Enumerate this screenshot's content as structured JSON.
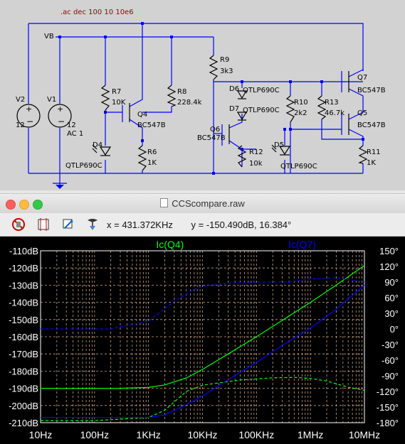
{
  "schematic": {
    "sim_command": ".ac dec 100 10 10e6",
    "net_labels": {
      "vb": "VB"
    },
    "components": {
      "v2": {
        "name": "V2",
        "value": "12"
      },
      "v1": {
        "name": "V1",
        "value1": "12",
        "value2": "AC 1"
      },
      "r7": {
        "name": "R7",
        "value": "10K"
      },
      "q4": {
        "name": "Q4",
        "value": "BC547B"
      },
      "d4": {
        "name": "D4",
        "value": "QTLP690C"
      },
      "r8": {
        "name": "R8",
        "value": "228.4k"
      },
      "r6": {
        "name": "R6",
        "value": "1K"
      },
      "r9": {
        "name": "R9",
        "value": "3k3"
      },
      "d6": {
        "name": "D6",
        "value": "QTLP690C"
      },
      "d7": {
        "name": "D7",
        "value": "QTLP690C"
      },
      "q6": {
        "name": "Q6",
        "value": "BC547B"
      },
      "r12": {
        "name": "R12",
        "value": "10k"
      },
      "d5": {
        "name": "D5",
        "value": "QTLP690C"
      },
      "r10": {
        "name": "R10",
        "value": "2k2"
      },
      "r13": {
        "name": "R13",
        "value": "46.7k"
      },
      "q7": {
        "name": "Q7",
        "value": "BC547B"
      },
      "q5": {
        "name": "Q5",
        "value": "BC547B"
      },
      "r11": {
        "name": "R11",
        "value": "1K"
      }
    }
  },
  "window": {
    "title": "CCScompare.raw"
  },
  "toolbar": {
    "x_readout": "x = 431.372KHz",
    "y_readout": "y = -150.490dB, 16.384°",
    "icons": [
      "no-cursor-icon",
      "autorange-icon",
      "zoom-icon",
      "probe-icon"
    ]
  },
  "colors": {
    "green": "#00ff00",
    "blue": "#0000ff",
    "grid": "#c8a080",
    "axis_text": "#ffffff"
  },
  "chart_data": {
    "type": "line",
    "xscale": "log",
    "xlim": [
      10,
      10000000
    ],
    "x_ticks": [
      10,
      100,
      1000,
      10000,
      100000,
      1000000,
      10000000
    ],
    "x_tick_labels": [
      "10Hz",
      "100Hz",
      "1KHz",
      "10KHz",
      "100KHz",
      "1MHz",
      "10MHz"
    ],
    "ylim_left": [
      -210,
      -110
    ],
    "y_left_ticks": [
      -110,
      -120,
      -130,
      -140,
      -150,
      -160,
      -170,
      -180,
      -190,
      -200,
      -210
    ],
    "y_left_tick_labels": [
      "-110dB",
      "-120dB",
      "-130dB",
      "-140dB",
      "-150dB",
      "-160dB",
      "-170dB",
      "-180dB",
      "-190dB",
      "-200dB",
      "-210dB"
    ],
    "ylim_right": [
      -180,
      150
    ],
    "y_right_ticks": [
      150,
      120,
      90,
      60,
      30,
      0,
      -30,
      -60,
      -90,
      -120,
      -150,
      -180
    ],
    "y_right_tick_labels": [
      "150°",
      "120°",
      "90°",
      "60°",
      "30°",
      "0°",
      "-30°",
      "-60°",
      "-90°",
      "-120°",
      "-150°",
      "-180°"
    ],
    "series": [
      {
        "name": "Ic(Q4)",
        "color": "#00ff00",
        "magnitude": [
          [
            10,
            -190
          ],
          [
            300,
            -190
          ],
          [
            1000,
            -189.5
          ],
          [
            2000,
            -188
          ],
          [
            5000,
            -184
          ],
          [
            10000,
            -179
          ],
          [
            30000,
            -170
          ],
          [
            100000,
            -160
          ],
          [
            300000,
            -150.5
          ],
          [
            1000000,
            -140
          ],
          [
            3000000,
            -130
          ],
          [
            10000000,
            -118.5
          ]
        ],
        "phase": [
          [
            10,
            -176
          ],
          [
            100,
            -176
          ],
          [
            1000,
            -170
          ],
          [
            2000,
            -156
          ],
          [
            5000,
            -120
          ],
          [
            10000,
            -108
          ],
          [
            50000,
            -98
          ],
          [
            200000,
            -94
          ],
          [
            500000,
            -93
          ],
          [
            1000000,
            -95
          ],
          [
            2000000,
            -100
          ],
          [
            5000000,
            -112
          ],
          [
            10000000,
            -118
          ]
        ]
      },
      {
        "name": "Ic(Q7)",
        "color": "#0000ff",
        "magnitude": [
          [
            10,
            -207
          ],
          [
            1000,
            -207
          ],
          [
            2000,
            -205.5
          ],
          [
            5000,
            -199.5
          ],
          [
            10000,
            -194.5
          ],
          [
            30000,
            -185
          ],
          [
            100000,
            -175
          ],
          [
            300000,
            -165
          ],
          [
            1000000,
            -155
          ],
          [
            3000000,
            -144
          ],
          [
            10000000,
            -130
          ]
        ],
        "phase": [
          [
            10,
            0
          ],
          [
            200,
            0
          ],
          [
            1000,
            15
          ],
          [
            3000,
            53
          ],
          [
            6000,
            72
          ],
          [
            10000,
            82
          ],
          [
            30000,
            88
          ],
          [
            100000,
            90
          ],
          [
            400000,
            90
          ],
          [
            1000000,
            96
          ],
          [
            3000000,
            98
          ],
          [
            10000000,
            90
          ]
        ]
      }
    ]
  }
}
